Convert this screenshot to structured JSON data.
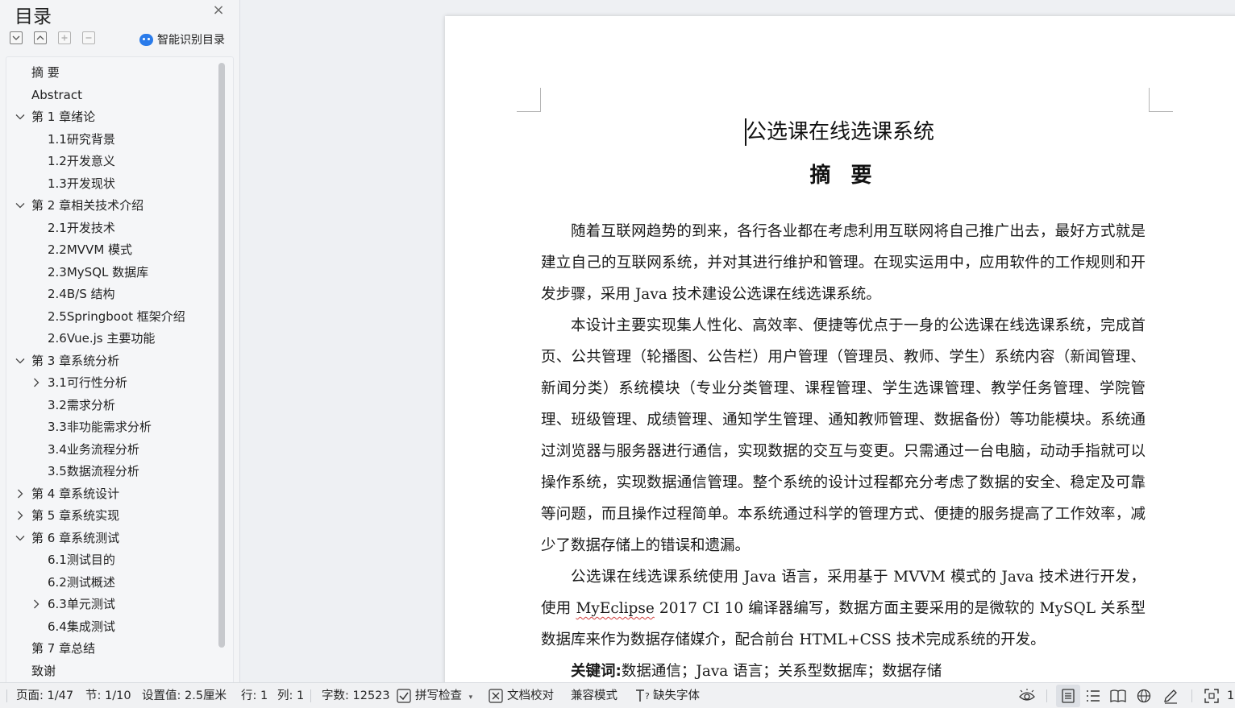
{
  "sidebar": {
    "title": "目录",
    "smart_label": "智能识别目录",
    "toc": [
      {
        "label": "摘  要",
        "level": 0,
        "chevron": "none"
      },
      {
        "label": "Abstract",
        "level": 0,
        "chevron": "none"
      },
      {
        "label": "第 1 章绪论",
        "level": 0,
        "chevron": "down"
      },
      {
        "label": "1.1研究背景",
        "level": 1,
        "chevron": "none"
      },
      {
        "label": "1.2开发意义",
        "level": 1,
        "chevron": "none"
      },
      {
        "label": "1.3开发现状",
        "level": 1,
        "chevron": "none"
      },
      {
        "label": "第 2 章相关技术介绍",
        "level": 0,
        "chevron": "down"
      },
      {
        "label": "2.1开发技术",
        "level": 1,
        "chevron": "none"
      },
      {
        "label": "2.2MVVM 模式",
        "level": 1,
        "chevron": "none"
      },
      {
        "label": "2.3MySQL 数据库",
        "level": 1,
        "chevron": "none"
      },
      {
        "label": "2.4B/S 结构",
        "level": 1,
        "chevron": "none"
      },
      {
        "label": "2.5Springboot 框架介绍",
        "level": 1,
        "chevron": "none"
      },
      {
        "label": "2.6Vue.js  主要功能",
        "level": 1,
        "chevron": "none"
      },
      {
        "label": "第 3 章系统分析",
        "level": 0,
        "chevron": "down"
      },
      {
        "label": "3.1可行性分析",
        "level": 1,
        "chevron": "right"
      },
      {
        "label": "3.2需求分析",
        "level": 1,
        "chevron": "none"
      },
      {
        "label": "3.3非功能需求分析",
        "level": 1,
        "chevron": "none"
      },
      {
        "label": "3.4业务流程分析",
        "level": 1,
        "chevron": "none"
      },
      {
        "label": "3.5数据流程分析",
        "level": 1,
        "chevron": "none"
      },
      {
        "label": "第 4 章系统设计",
        "level": 0,
        "chevron": "right"
      },
      {
        "label": "第 5 章系统实现",
        "level": 0,
        "chevron": "right"
      },
      {
        "label": "第 6 章系统测试",
        "level": 0,
        "chevron": "down"
      },
      {
        "label": "6.1测试目的",
        "level": 1,
        "chevron": "none"
      },
      {
        "label": "6.2测试概述",
        "level": 1,
        "chevron": "none"
      },
      {
        "label": "6.3单元测试",
        "level": 1,
        "chevron": "right"
      },
      {
        "label": "6.4集成测试",
        "level": 1,
        "chevron": "none"
      },
      {
        "label": "第 7 章总结",
        "level": 0,
        "chevron": "none"
      },
      {
        "label": "致谢",
        "level": 0,
        "chevron": "none"
      }
    ]
  },
  "doc": {
    "title": "公选课在线选课系统",
    "abstract_heading": "摘 要",
    "p1": "随着互联网趋势的到来，各行各业都在考虑利用互联网将自己推广出去，最好方式就是建立自己的互联网系统，并对其进行维护和管理。在现实运用中，应用软件的工作规则和开发步骤，采用 Java 技术建设公选课在线选课系统。",
    "p2": "本设计主要实现集人性化、高效率、便捷等优点于一身的公选课在线选课系统，完成首页、公共管理（轮播图、公告栏）用户管理（管理员、教师、学生）系统内容（新闻管理、新闻分类）系统模块（专业分类管理、课程管理、学生选课管理、教学任务管理、学院管理、班级管理、成绩管理、通知学生管理、通知教师管理、数据备份）等功能模块。系统通过浏览器与服务器进行通信，实现数据的交互与变更。只需通过一台电脑，动动手指就可以操作系统，实现数据通信管理。整个系统的设计过程都充分考虑了数据的安全、稳定及可靠等问题，而且操作过程简单。本系统通过科学的管理方式、便捷的服务提高了工作效率，减少了数据存储上的错误和遗漏。",
    "p3_a": "公选课在线选课系统使用 Java 语言，采用基于  MVVM 模式的 Java 技术进行开发，使用  ",
    "p3_b": "MyEclipse",
    "p3_c": " 2017 CI 10  编译器编写，数据方面主要采用的是微软的 MySQL 关系型数据库来作为数据存储媒介，配合前台 HTML+CSS  技术完成系统的开发。",
    "kw_label": "关键词:",
    "kw_text": "数据通信；Java 语言；关系型数据库；数据存储"
  },
  "status": {
    "page": "页面: 1/47",
    "section": "节: 1/10",
    "setting": "设置值: 2.5厘米",
    "row": "行: 1",
    "col": "列: 1",
    "words": "字数: 12523",
    "spell": "拼写检查",
    "proof": "文档校对",
    "compat": "兼容模式",
    "missing_font": "缺失字体",
    "zoom_cut": "1"
  }
}
